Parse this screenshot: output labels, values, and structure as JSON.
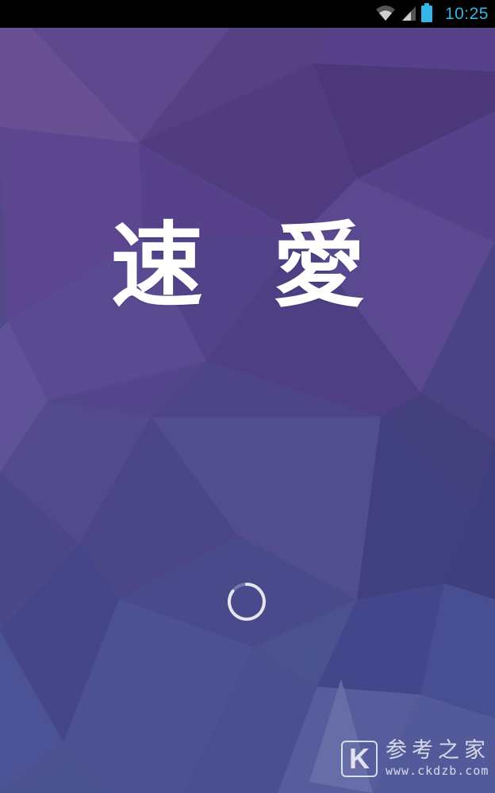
{
  "status_bar": {
    "time": "10:25",
    "icons": [
      "wifi-icon",
      "cell-signal-icon",
      "battery-icon"
    ],
    "time_color": "#33b5e5"
  },
  "splash": {
    "app_name": "速 愛",
    "loading_indicator": "spinner-icon"
  },
  "watermark": {
    "logo_letter": "K",
    "title": "参考之家",
    "url": "www.ckdzb.com"
  },
  "colors": {
    "background_top": "#5b4488",
    "background_bottom": "#4a5290",
    "text": "#ffffff"
  }
}
